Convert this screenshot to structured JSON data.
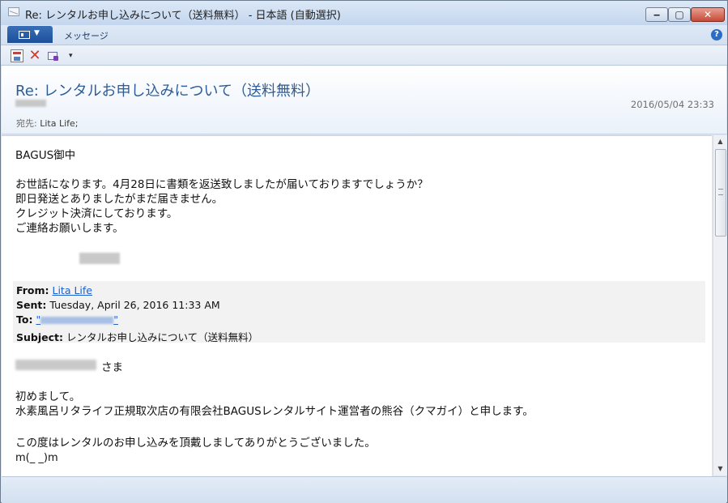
{
  "window": {
    "title": "Re: レンタルお申し込みについて（送料無料） - 日本語 (自動選択)",
    "minimize_label": "‒",
    "maximize_label": "▢",
    "close_label": "✕"
  },
  "ribbon": {
    "tab_message": "メッセージ",
    "help_label": "?"
  },
  "toolbar": {
    "delete_glyph": "✕",
    "more_glyph": "▾"
  },
  "header": {
    "subject": "Re: レンタルお申し込みについて（送料無料）",
    "date": "2016/05/04 23:33",
    "to_label": "宛先:",
    "to_value": "Lita Life;"
  },
  "body": {
    "salutation": "BAGUS御中",
    "lines": [
      "お世話になります。4月28日に書類を返送致しましたが届いておりますでしょうか？",
      "即日発送とありましたがまだ届きません。",
      "クレジット決済にしております。",
      "ご連絡お願いします。"
    ]
  },
  "quoted": {
    "from_label": "From:",
    "from_value": "Lita Life",
    "sent_label": "Sent:",
    "sent_value": "Tuesday, April 26, 2016 11:33 AM",
    "to_label": "To:",
    "to_prefix": "\"",
    "to_suffix": "\"",
    "subject_label": "Subject:",
    "subject_value": "レンタルお申し込みについて（送料無料）"
  },
  "reply": {
    "greeting_suffix": "さま",
    "lines": [
      "初めまして。",
      "水素風呂リタライフ正規取次店の有限会社BAGUSレンタルサイト運営者の熊谷（クマガイ）と申します。",
      "この度はレンタルのお申し込みを頂戴しましてありがとうございました。",
      "m(_ _)m"
    ]
  },
  "scrollbar": {
    "up_glyph": "▲",
    "down_glyph": "▼"
  }
}
